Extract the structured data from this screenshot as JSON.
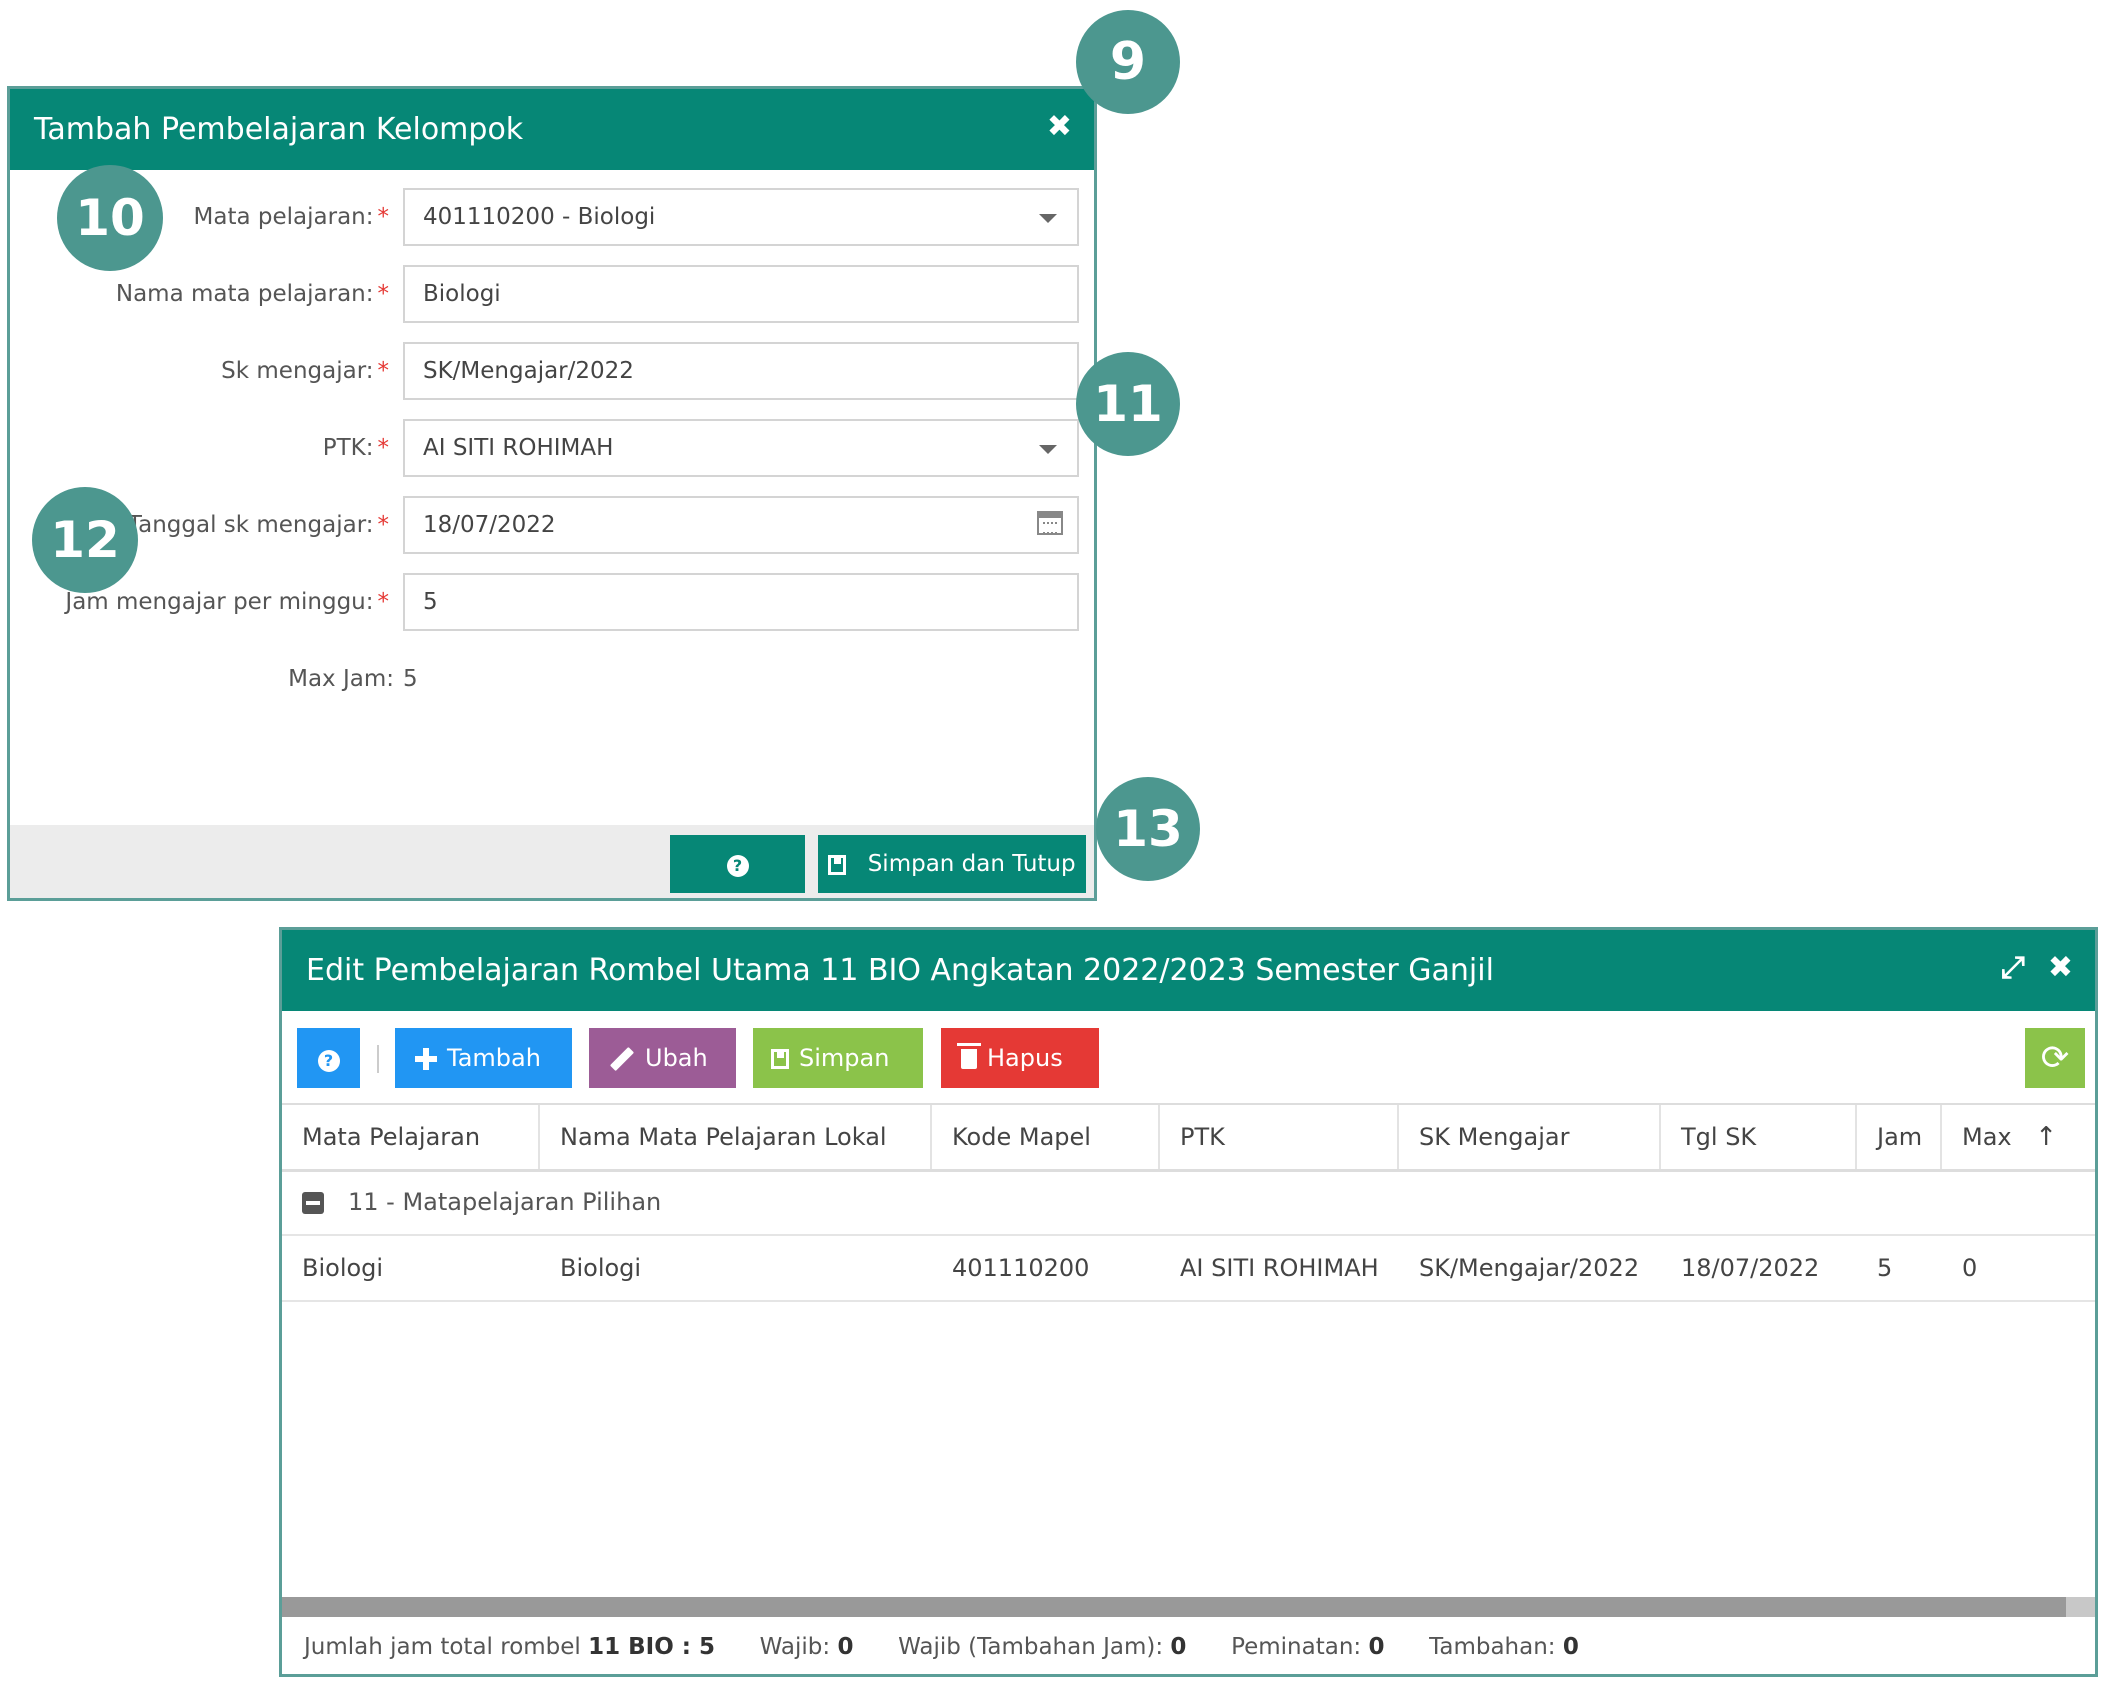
{
  "dialog_add": {
    "title": "Tambah Pembelajaran Kelompok",
    "fields": [
      {
        "label": "Mata pelajaran:",
        "value": "401110200 - Biologi"
      },
      {
        "label": "Nama mata pelajaran:",
        "value": "Biologi"
      },
      {
        "label": "Sk mengajar:",
        "value": "SK/Mengajar/2022"
      },
      {
        "label": "PTK:",
        "value": "AI SITI ROHIMAH"
      },
      {
        "label": "Tanggal sk mengajar:",
        "value": "18/07/2022"
      },
      {
        "label": "Jam mengajar per minggu:",
        "value": "5"
      }
    ],
    "required_mark": "*",
    "max_jam_label": "Max Jam:",
    "max_jam_value": "5",
    "help_icon": "?",
    "save_close_label": "Simpan dan Tutup"
  },
  "markers": [
    "9",
    "10",
    "11",
    "12",
    "13"
  ],
  "dialog_edit": {
    "title": "Edit Pembelajaran Rombel Utama 11 BIO Angkatan 2022/2023 Semester Ganjil",
    "toolbar": {
      "help_icon": "?",
      "add_label": "Tambah",
      "edit_label": "Ubah",
      "save_label": "Simpan",
      "delete_label": "Hapus",
      "refresh_icon": "⟳"
    },
    "columns": [
      "Mata Pelajaran",
      "Nama Mata Pelajaran Lokal",
      "Kode Mapel",
      "PTK",
      "SK Mengajar",
      "Tgl SK",
      "Jam",
      "Max"
    ],
    "sort_indicator": "↑",
    "group_label": "11 - Matapelajaran Pilihan",
    "rows": [
      [
        "Biologi",
        "Biologi",
        "401110200",
        "AI SITI ROHIMAH",
        "SK/Mengajar/2022",
        "18/07/2022",
        "5",
        "0"
      ]
    ],
    "summary": {
      "total_label": "Jumlah jam total rombel",
      "total_value": "11 BIO : 5",
      "wajib_label": "Wajib:",
      "wajib_value": "0",
      "wajib_tambahan_label": "Wajib (Tambahan Jam):",
      "wajib_tambahan_value": "0",
      "peminatan_label": "Peminatan:",
      "peminatan_value": "0",
      "tambahan_label": "Tambahan:",
      "tambahan_value": "0"
    }
  },
  "colors": {
    "header_teal": "#068776",
    "marker": "#4c978f",
    "btn_blue": "#2196f3",
    "btn_purple": "#9c5c96",
    "btn_green": "#8bc34a",
    "btn_red": "#e53935"
  }
}
